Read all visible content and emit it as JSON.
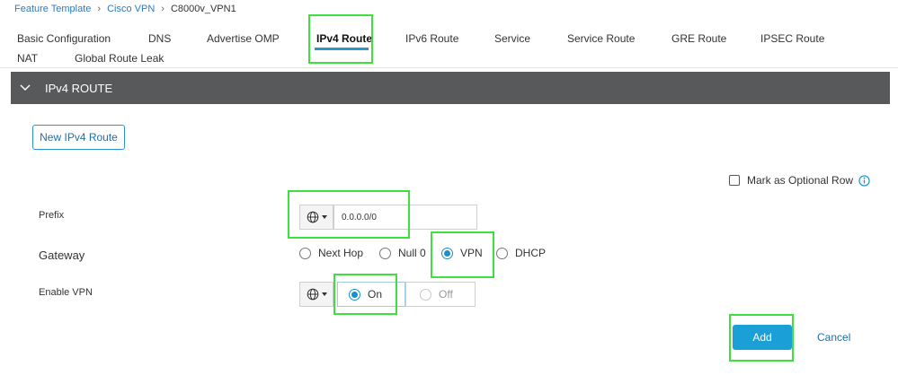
{
  "breadcrumb": {
    "items": [
      "Feature Template",
      "Cisco VPN",
      "C8000v_VPN1"
    ]
  },
  "tabs": [
    {
      "label": "Basic Configuration",
      "active": false
    },
    {
      "label": "DNS",
      "active": false
    },
    {
      "label": "Advertise OMP",
      "active": false
    },
    {
      "label": "IPv4 Route",
      "active": true
    },
    {
      "label": "IPv6 Route",
      "active": false
    },
    {
      "label": "Service",
      "active": false
    },
    {
      "label": "Service Route",
      "active": false
    },
    {
      "label": "GRE Route",
      "active": false
    },
    {
      "label": "IPSEC Route",
      "active": false
    },
    {
      "label": "NAT",
      "active": false
    },
    {
      "label": "Global Route Leak",
      "active": false
    }
  ],
  "section": {
    "title": "IPv4 ROUTE",
    "icon": "chevron-down-icon"
  },
  "new_route_button": "New IPv4 Route",
  "optional_row": {
    "label": "Mark as Optional Row",
    "checked": false,
    "icon": "info-icon"
  },
  "form": {
    "prefix": {
      "label": "Prefix",
      "scope_icon": "globe-icon",
      "value": "0.0.0.0/0"
    },
    "gateway": {
      "label": "Gateway",
      "options": [
        "Next Hop",
        "Null 0",
        "VPN",
        "DHCP"
      ],
      "selected": "VPN"
    },
    "enable_vpn": {
      "label": "Enable VPN",
      "scope_icon": "globe-icon",
      "options": [
        "On",
        "Off"
      ],
      "selected": "On"
    }
  },
  "actions": {
    "add": "Add",
    "cancel": "Cancel"
  },
  "colors": {
    "accent": "#1a9fd6",
    "section_bar": "#58595b",
    "highlight": "#3ee03e",
    "link": "#2a7bbf"
  }
}
